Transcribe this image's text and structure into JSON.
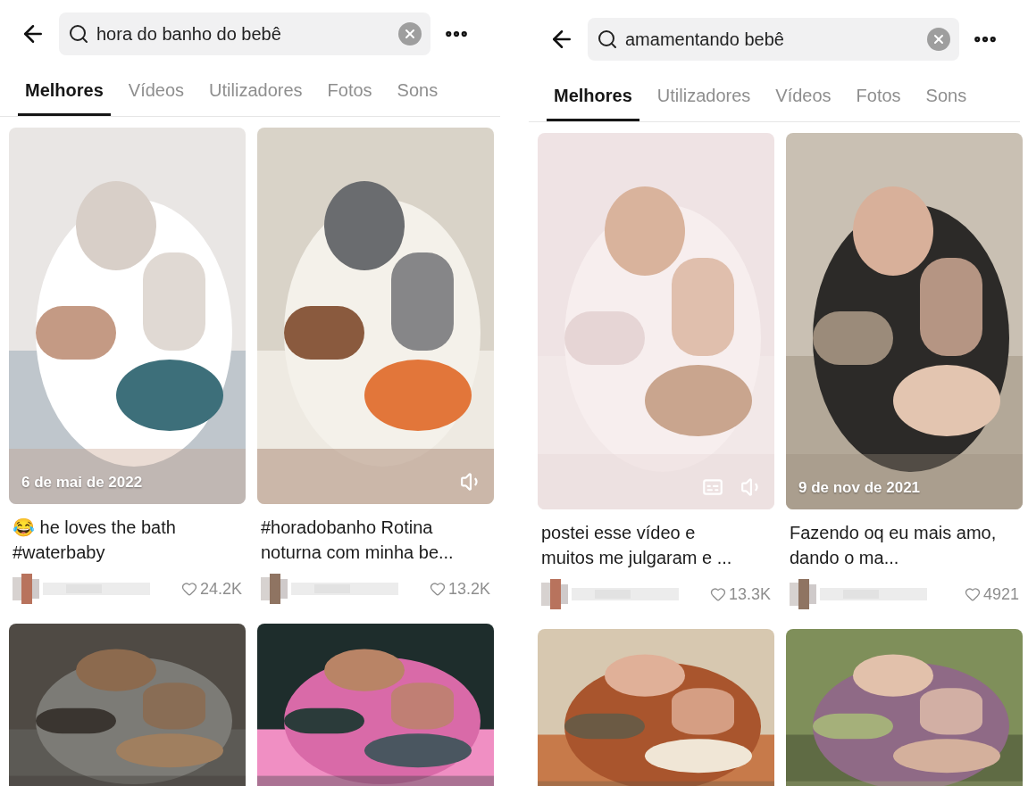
{
  "panels": [
    {
      "search": {
        "query": "hora do banho do bebê"
      },
      "tabs": [
        {
          "label": "Melhores",
          "selected": true
        },
        {
          "label": "Vídeos",
          "selected": false
        },
        {
          "label": "Utilizadores",
          "selected": false
        },
        {
          "label": "Fotos",
          "selected": false
        },
        {
          "label": "Sons",
          "selected": false
        }
      ],
      "results": [
        {
          "date": "6 de mai de 2022",
          "caption": "😂 he loves the bath #waterbaby",
          "likes": "24.2K"
        },
        {
          "caption": "#horadobanho Rotina noturna com minha be...",
          "likes": "13.2K",
          "sound": true
        }
      ]
    },
    {
      "search": {
        "query": "amamentando bebê"
      },
      "tabs": [
        {
          "label": "Melhores",
          "selected": true
        },
        {
          "label": "Utilizadores",
          "selected": false
        },
        {
          "label": "Vídeos",
          "selected": false
        },
        {
          "label": "Fotos",
          "selected": false
        },
        {
          "label": "Sons",
          "selected": false
        }
      ],
      "results": [
        {
          "caption": "postei esse vídeo e muitos me julgaram e ...",
          "likes": "13.3K",
          "captions": true,
          "sound": true
        },
        {
          "date": "9 de nov de 2021",
          "caption": "Fazendo oq eu mais amo, dando o ma...",
          "likes": "4921"
        }
      ]
    }
  ]
}
